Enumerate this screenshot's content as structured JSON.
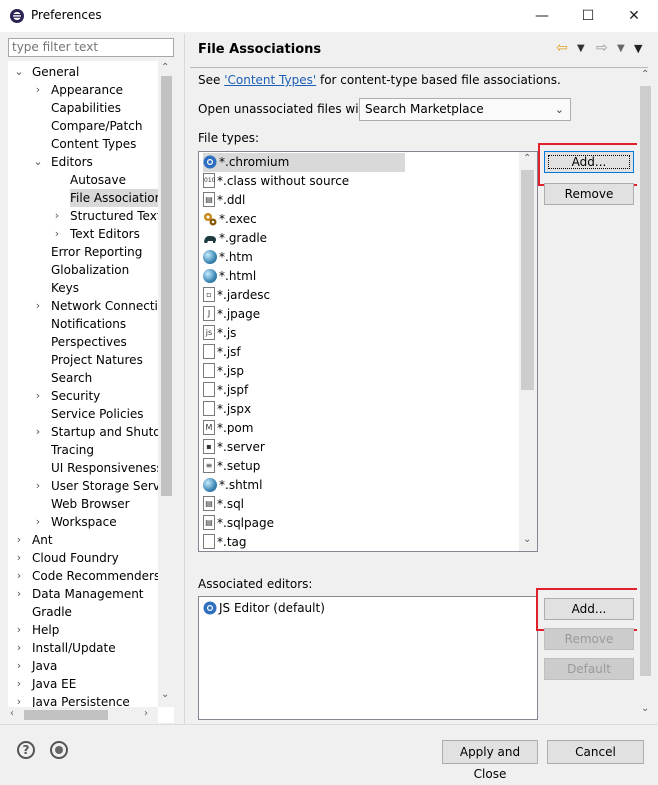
{
  "window": {
    "title": "Preferences",
    "controls": [
      "—",
      "☐",
      "✕"
    ]
  },
  "filter": {
    "placeholder": "type filter text"
  },
  "tree": [
    {
      "label": "General",
      "level": 0,
      "twisty": "open"
    },
    {
      "label": "Appearance",
      "level": 1,
      "twisty": "closed"
    },
    {
      "label": "Capabilities",
      "level": 1,
      "twisty": ""
    },
    {
      "label": "Compare/Patch",
      "level": 1,
      "twisty": ""
    },
    {
      "label": "Content Types",
      "level": 1,
      "twisty": ""
    },
    {
      "label": "Editors",
      "level": 1,
      "twisty": "open"
    },
    {
      "label": "Autosave",
      "level": 2,
      "twisty": ""
    },
    {
      "label": "File Associations",
      "level": 2,
      "twisty": "",
      "selected": true
    },
    {
      "label": "Structured Text",
      "level": 2,
      "twisty": "closed"
    },
    {
      "label": "Text Editors",
      "level": 2,
      "twisty": "closed"
    },
    {
      "label": "Error Reporting",
      "level": 1,
      "twisty": ""
    },
    {
      "label": "Globalization",
      "level": 1,
      "twisty": ""
    },
    {
      "label": "Keys",
      "level": 1,
      "twisty": ""
    },
    {
      "label": "Network Connection",
      "level": 1,
      "twisty": "closed"
    },
    {
      "label": "Notifications",
      "level": 1,
      "twisty": ""
    },
    {
      "label": "Perspectives",
      "level": 1,
      "twisty": ""
    },
    {
      "label": "Project Natures",
      "level": 1,
      "twisty": ""
    },
    {
      "label": "Search",
      "level": 1,
      "twisty": ""
    },
    {
      "label": "Security",
      "level": 1,
      "twisty": "closed"
    },
    {
      "label": "Service Policies",
      "level": 1,
      "twisty": ""
    },
    {
      "label": "Startup and Shutdo",
      "level": 1,
      "twisty": "closed"
    },
    {
      "label": "Tracing",
      "level": 1,
      "twisty": ""
    },
    {
      "label": "UI Responsiveness M",
      "level": 1,
      "twisty": ""
    },
    {
      "label": "User Storage Service",
      "level": 1,
      "twisty": "closed"
    },
    {
      "label": "Web Browser",
      "level": 1,
      "twisty": ""
    },
    {
      "label": "Workspace",
      "level": 1,
      "twisty": "closed"
    },
    {
      "label": "Ant",
      "level": 0,
      "twisty": "closed"
    },
    {
      "label": "Cloud Foundry",
      "level": 0,
      "twisty": "closed"
    },
    {
      "label": "Code Recommenders",
      "level": 0,
      "twisty": "closed"
    },
    {
      "label": "Data Management",
      "level": 0,
      "twisty": "closed"
    },
    {
      "label": "Gradle",
      "level": 0,
      "twisty": ""
    },
    {
      "label": "Help",
      "level": 0,
      "twisty": "closed"
    },
    {
      "label": "Install/Update",
      "level": 0,
      "twisty": "closed"
    },
    {
      "label": "Java",
      "level": 0,
      "twisty": "closed"
    },
    {
      "label": "Java EE",
      "level": 0,
      "twisty": "closed"
    },
    {
      "label": "Java Persistence",
      "level": 0,
      "twisty": "closed"
    }
  ],
  "page": {
    "title": "File Associations",
    "see_prefix": "See ",
    "see_link": "'Content Types'",
    "see_suffix": " for content-type based file associations.",
    "open_label": "Open unassociated files with:",
    "open_value": "Search Marketplace",
    "filetypes_label": "File types:",
    "assoc_label": "Associated editors:"
  },
  "file_types": [
    {
      "label": "*.chromium",
      "icon": "chromium-icon",
      "selected": true
    },
    {
      "label": "*.class without source",
      "icon": "class-file-icon"
    },
    {
      "label": "*.ddl",
      "icon": "ddl-file-icon"
    },
    {
      "label": "*.exec",
      "icon": "gears-icon"
    },
    {
      "label": "*.gradle",
      "icon": "gradle-elephant-icon"
    },
    {
      "label": "*.htm",
      "icon": "globe-icon"
    },
    {
      "label": "*.html",
      "icon": "globe-icon"
    },
    {
      "label": "*.jardesc",
      "icon": "jardesc-icon"
    },
    {
      "label": "*.jpage",
      "icon": "jpage-icon"
    },
    {
      "label": "*.js",
      "icon": "js-file-icon"
    },
    {
      "label": "*.jsf",
      "icon": "text-file-icon"
    },
    {
      "label": "*.jsp",
      "icon": "text-file-icon"
    },
    {
      "label": "*.jspf",
      "icon": "text-file-icon"
    },
    {
      "label": "*.jspx",
      "icon": "text-file-icon"
    },
    {
      "label": "*.pom",
      "icon": "maven-file-icon"
    },
    {
      "label": "*.server",
      "icon": "server-file-icon"
    },
    {
      "label": "*.setup",
      "icon": "setup-file-icon"
    },
    {
      "label": "*.shtml",
      "icon": "globe-icon"
    },
    {
      "label": "*.sql",
      "icon": "sql-file-icon"
    },
    {
      "label": "*.sqlpage",
      "icon": "sql-file-icon"
    },
    {
      "label": "*.tag",
      "icon": "text-file-icon"
    }
  ],
  "editors": [
    {
      "label": "JS Editor (default)",
      "icon": "chromium-icon"
    }
  ],
  "buttons": {
    "add_type": "Add...",
    "remove_type": "Remove",
    "add_editor": "Add...",
    "remove_editor": "Remove",
    "default_editor": "Default",
    "apply_close": "Apply and Close",
    "cancel": "Cancel"
  },
  "colors": {
    "highlight_box": "#e0202a",
    "link": "#1b5fb6",
    "selection": "#d9d9d9"
  }
}
